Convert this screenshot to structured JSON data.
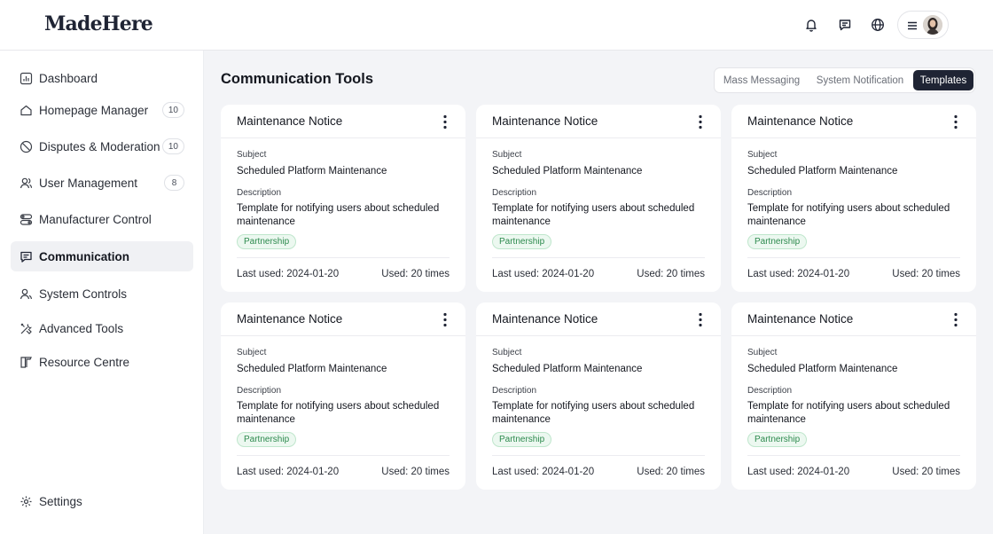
{
  "brand": {
    "logo": "MadeHere"
  },
  "header": {
    "icons": [
      "bell-icon",
      "chat-icon",
      "globe-icon",
      "menu-icon",
      "avatar"
    ]
  },
  "sidebar": {
    "items": [
      {
        "label": "Dashboard",
        "icon": "chart-icon",
        "badge": null,
        "active": false
      },
      {
        "label": "Homepage Manager",
        "icon": "home-icon",
        "badge": "10",
        "active": false
      },
      {
        "label": "Disputes & Moderation",
        "icon": "ban-icon",
        "badge": "10",
        "active": false
      },
      {
        "label": "User Management",
        "icon": "users-icon",
        "badge": "8",
        "active": false
      },
      {
        "label": "Manufacturer Control",
        "icon": "toggles-icon",
        "badge": null,
        "active": false
      },
      {
        "label": "Communication",
        "icon": "message-icon",
        "badge": null,
        "active": true
      },
      {
        "label": "System Controls",
        "icon": "user-group-icon",
        "badge": null,
        "active": false
      },
      {
        "label": "Advanced Tools",
        "icon": "tools-icon",
        "badge": null,
        "active": false
      },
      {
        "label": "Resource Centre",
        "icon": "book-icon",
        "badge": null,
        "active": false
      }
    ],
    "settings": {
      "label": "Settings",
      "icon": "gear-icon"
    }
  },
  "main": {
    "title": "Communication Tools",
    "tabs": [
      {
        "label": "Mass Messaging",
        "active": false
      },
      {
        "label": "System Notification",
        "active": false
      },
      {
        "label": "Templates",
        "active": true
      }
    ],
    "cards": [
      {
        "title": "Maintenance Notice",
        "subject_label": "Subject",
        "subject": "Scheduled Platform Maintenance",
        "description_label": "Description",
        "description": "Template for notifying users about scheduled maintenance",
        "tag": "Partnership",
        "last_used": "Last used: 2024-01-20",
        "used": "Used: 20 times"
      },
      {
        "title": "Maintenance Notice",
        "subject_label": "Subject",
        "subject": "Scheduled Platform Maintenance",
        "description_label": "Description",
        "description": "Template for notifying users about scheduled maintenance",
        "tag": "Partnership",
        "last_used": "Last used: 2024-01-20",
        "used": "Used: 20 times"
      },
      {
        "title": "Maintenance Notice",
        "subject_label": "Subject",
        "subject": "Scheduled Platform Maintenance",
        "description_label": "Description",
        "description": "Template for notifying users about scheduled maintenance",
        "tag": "Partnership",
        "last_used": "Last used: 2024-01-20",
        "used": "Used: 20 times"
      },
      {
        "title": "Maintenance Notice",
        "subject_label": "Subject",
        "subject": "Scheduled Platform Maintenance",
        "description_label": "Description",
        "description": "Template for notifying users about scheduled maintenance",
        "tag": "Partnership",
        "last_used": "Last used: 2024-01-20",
        "used": "Used: 20 times"
      },
      {
        "title": "Maintenance Notice",
        "subject_label": "Subject",
        "subject": "Scheduled Platform Maintenance",
        "description_label": "Description",
        "description": "Template for notifying users about scheduled maintenance",
        "tag": "Partnership",
        "last_used": "Last used: 2024-01-20",
        "used": "Used: 20 times"
      },
      {
        "title": "Maintenance Notice",
        "subject_label": "Subject",
        "subject": "Scheduled Platform Maintenance",
        "description_label": "Description",
        "description": "Template for notifying users about scheduled maintenance",
        "tag": "Partnership",
        "last_used": "Last used: 2024-01-20",
        "used": "Used: 20 times"
      }
    ]
  },
  "colors": {
    "accent": "#1f2434",
    "tag_text": "#2d8a4e",
    "tag_bg": "#ecf8f0",
    "page_bg": "#f3f4f7"
  }
}
